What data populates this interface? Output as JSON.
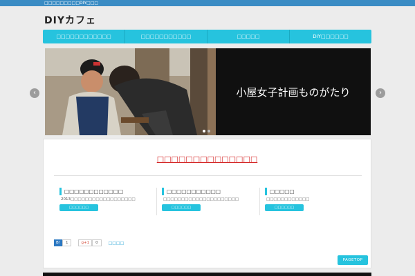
{
  "topbar": {
    "text": "□□□□□□□□□DIY□□□"
  },
  "logo": {
    "text": "DIYカフェ"
  },
  "nav": {
    "items": [
      {
        "label": "□□□□□□□□□□□□"
      },
      {
        "label": "□□□□□□□□□□□"
      },
      {
        "label": "□□□□□"
      },
      {
        "label": "DIY□□□□□□"
      }
    ]
  },
  "hero": {
    "caption": "小屋女子計画ものがたり"
  },
  "section": {
    "title": "□□□□□□□□□□□□□□"
  },
  "columns": [
    {
      "heading": "□□□□□□□□□□□□",
      "desc": "2013□□□□□□□□□□□□□□□□□□",
      "button": "□□□□□□"
    },
    {
      "heading": "□□□□□□□□□□□",
      "desc": "□□□□□□□□□□□□□□□□□□□□□",
      "button": "□□□□□□"
    },
    {
      "heading": "□□□□□",
      "desc": "□□□□□□□□□□□□",
      "button": "□□□□□□"
    }
  ],
  "social": {
    "hatena_label": "B!",
    "hatena_count": "1",
    "gplus_label": "g+1",
    "gplus_count": "0",
    "share_link": "□□□□"
  },
  "pagetop": {
    "label": "PAGETOP"
  },
  "colors": {
    "accent": "#26c3de",
    "topbar": "#3a8cc4",
    "title_red": "#d42626"
  }
}
